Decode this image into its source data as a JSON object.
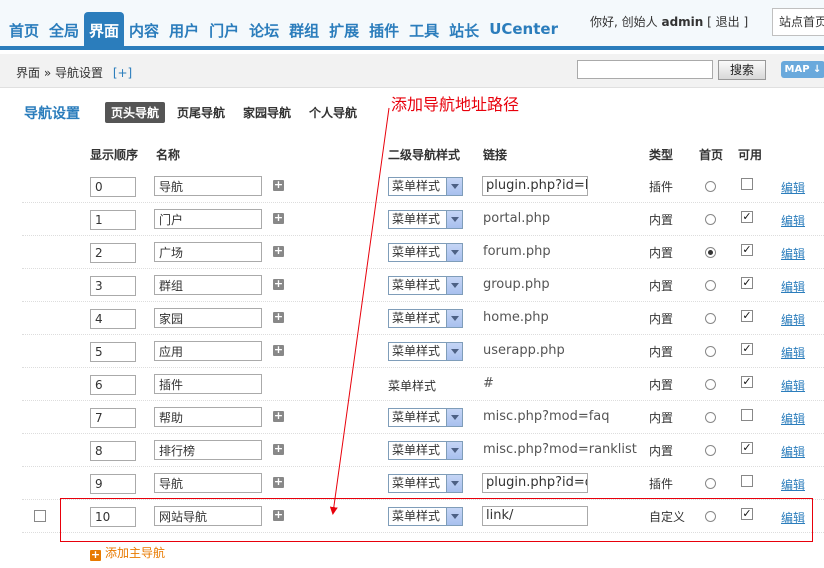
{
  "nav": {
    "items": [
      {
        "label": "首页",
        "active": false
      },
      {
        "label": "全局",
        "active": false
      },
      {
        "label": "界面",
        "active": true
      },
      {
        "label": "内容",
        "active": false
      },
      {
        "label": "用户",
        "active": false
      },
      {
        "label": "门户",
        "active": false
      },
      {
        "label": "论坛",
        "active": false
      },
      {
        "label": "群组",
        "active": false
      },
      {
        "label": "扩展",
        "active": false
      },
      {
        "label": "插件",
        "active": false
      },
      {
        "label": "工具",
        "active": false
      },
      {
        "label": "站长",
        "active": false
      },
      {
        "label": "UCenter",
        "active": false
      }
    ],
    "greeting": "你好, 创始人",
    "username": "admin",
    "logout": "[ 退出 ]",
    "site_home": "站点首页"
  },
  "breadcrumb": {
    "path": "界面 » 导航设置",
    "add": "[+]",
    "search_button": "搜索",
    "map_button": "MAP ↓"
  },
  "page": {
    "title": "导航设置",
    "tabs": [
      {
        "label": "页头导航",
        "active": true
      },
      {
        "label": "页尾导航",
        "active": false
      },
      {
        "label": "家园导航",
        "active": false
      },
      {
        "label": "个人导航",
        "active": false
      }
    ],
    "annotation": "添加导航地址路径"
  },
  "table": {
    "headers": {
      "order": "显示顺序",
      "name": "名称",
      "sub_style": "二级导航样式",
      "link": "链接",
      "type": "类型",
      "home": "首页",
      "enabled": "可用"
    },
    "rows": [
      {
        "order": "0",
        "name": "导航",
        "style": "菜单样式",
        "style_select": true,
        "link": "plugin.php?id=D",
        "link_input": true,
        "type": "插件",
        "home": false,
        "enabled": false,
        "edit": "编辑"
      },
      {
        "order": "1",
        "name": "门户",
        "style": "菜单样式",
        "style_select": true,
        "link": "portal.php",
        "link_input": false,
        "type": "内置",
        "home": false,
        "enabled": true,
        "edit": "编辑"
      },
      {
        "order": "2",
        "name": "广场",
        "style": "菜单样式",
        "style_select": true,
        "link": "forum.php",
        "link_input": false,
        "type": "内置",
        "home": true,
        "enabled": true,
        "edit": "编辑"
      },
      {
        "order": "3",
        "name": "群组",
        "style": "菜单样式",
        "style_select": true,
        "link": "group.php",
        "link_input": false,
        "type": "内置",
        "home": false,
        "enabled": true,
        "edit": "编辑"
      },
      {
        "order": "4",
        "name": "家园",
        "style": "菜单样式",
        "style_select": true,
        "link": "home.php",
        "link_input": false,
        "type": "内置",
        "home": false,
        "enabled": true,
        "edit": "编辑"
      },
      {
        "order": "5",
        "name": "应用",
        "style": "菜单样式",
        "style_select": true,
        "link": "userapp.php",
        "link_input": false,
        "type": "内置",
        "home": false,
        "enabled": true,
        "edit": "编辑"
      },
      {
        "order": "6",
        "name": "插件",
        "style": "菜单样式",
        "style_select": false,
        "link": "#",
        "link_input": false,
        "type": "内置",
        "home": false,
        "enabled": true,
        "edit": "编辑"
      },
      {
        "order": "7",
        "name": "帮助",
        "style": "菜单样式",
        "style_select": true,
        "link": "misc.php?mod=faq",
        "link_input": false,
        "type": "内置",
        "home": false,
        "enabled": false,
        "edit": "编辑"
      },
      {
        "order": "8",
        "name": "排行榜",
        "style": "菜单样式",
        "style_select": true,
        "link": "misc.php?mod=ranklist",
        "link_input": false,
        "type": "内置",
        "home": false,
        "enabled": true,
        "edit": "编辑"
      },
      {
        "order": "9",
        "name": "导航",
        "style": "菜单样式",
        "style_select": true,
        "link": "plugin.php?id=d",
        "link_input": true,
        "type": "插件",
        "home": false,
        "enabled": false,
        "edit": "编辑"
      },
      {
        "order": "10",
        "name": "网站导航",
        "style": "菜单样式",
        "style_select": true,
        "link": "link/",
        "link_input": true,
        "type": "自定义",
        "home": false,
        "enabled": true,
        "edit": "编辑",
        "row_checkbox": true
      }
    ],
    "add_main": "添加主导航"
  },
  "colors": {
    "accent": "#2b7dbc",
    "annotation": "#e8000b",
    "add_link": "#e87a00"
  }
}
